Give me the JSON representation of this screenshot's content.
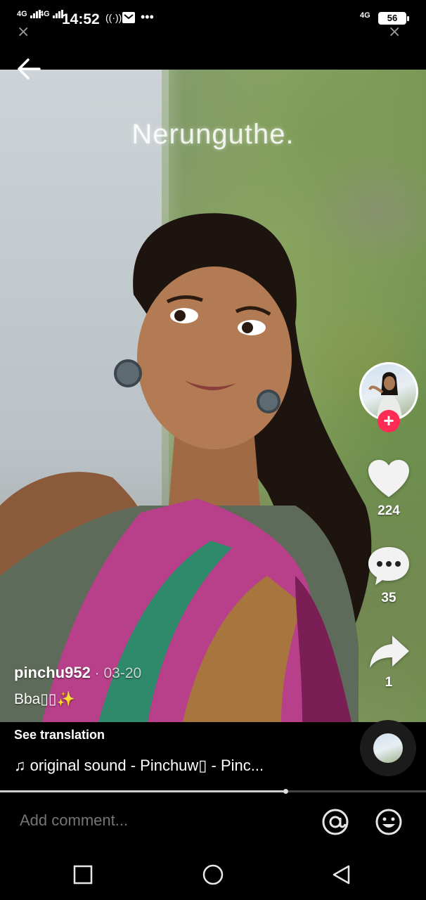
{
  "status_bar": {
    "signal_1": "4G",
    "signal_2": "4G",
    "time": "14:52",
    "network_right": "4G",
    "battery": "56"
  },
  "video": {
    "overlay_text": "Nerunguthe."
  },
  "actions": {
    "follow_label": "+",
    "likes": "224",
    "comments": "35",
    "shares": "1"
  },
  "post": {
    "username": "pinchu952",
    "date": " · 03-20",
    "description": "Bba▯▯✨",
    "see_translation": "See translation",
    "sound": "♫ original sound - Pinchuw▯ - Pinc..."
  },
  "playback": {
    "progress": 0.67
  },
  "comment": {
    "placeholder": "Add comment..."
  },
  "icons": {
    "back": "back-arrow-icon",
    "like": "heart-icon",
    "comment": "comment-bubble-icon",
    "share": "share-arrow-icon",
    "mention": "at-sign-icon",
    "emoji": "emoji-icon",
    "nav_recents": "square-icon",
    "nav_home": "circle-icon",
    "nav_back": "triangle-back-icon"
  }
}
